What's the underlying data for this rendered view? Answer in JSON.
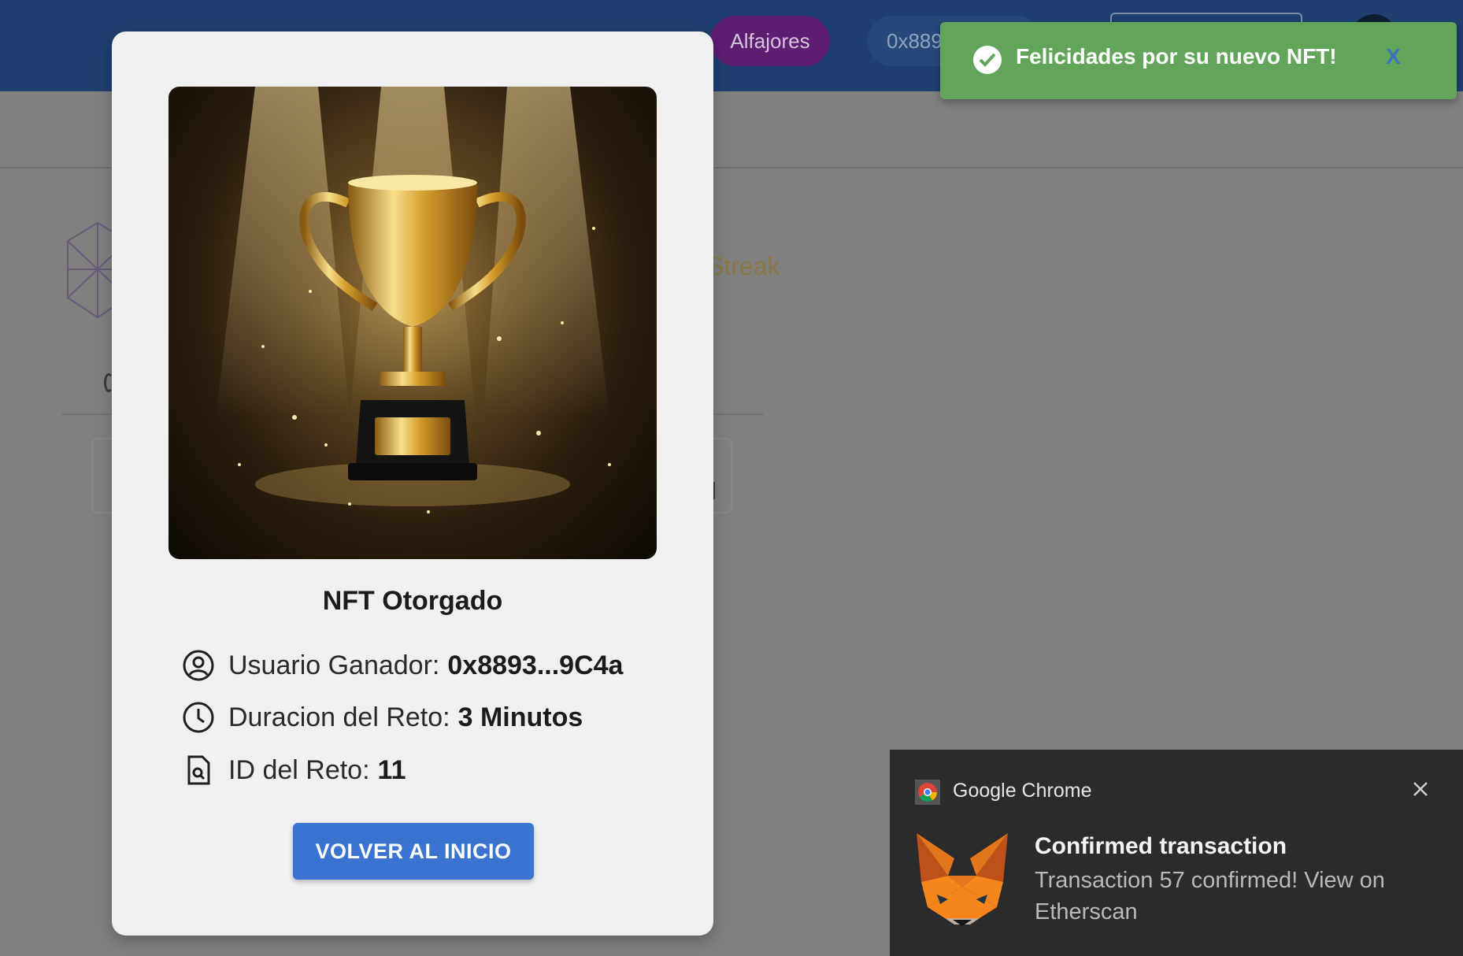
{
  "header": {
    "network_label": "Alfajores",
    "address_short": "0x889"
  },
  "background": {
    "streak_text": "Streak"
  },
  "modal": {
    "title": "NFT Otorgado",
    "winner_label": "Usuario Ganador:",
    "winner_value": "0x8893...9C4a",
    "duration_label": "Duracion del Reto:",
    "duration_value": "3 Minutos",
    "id_label": "ID del Reto:",
    "id_value": "11",
    "button_label": "VOLVER AL INICIO",
    "image_icon": "trophy-icon"
  },
  "toast": {
    "message": "Felicidades por su nuevo NFT!",
    "close_label": "X",
    "color": "#62a55a"
  },
  "notification": {
    "app_name": "Google Chrome",
    "title": "Confirmed transaction",
    "body": "Transaction 57 confirmed! View on Etherscan",
    "icon": "metamask-fox-icon"
  },
  "colors": {
    "primary_button": "#3a74d0",
    "topbar": "#1f3f70",
    "network_pill": "#5d1d70"
  }
}
